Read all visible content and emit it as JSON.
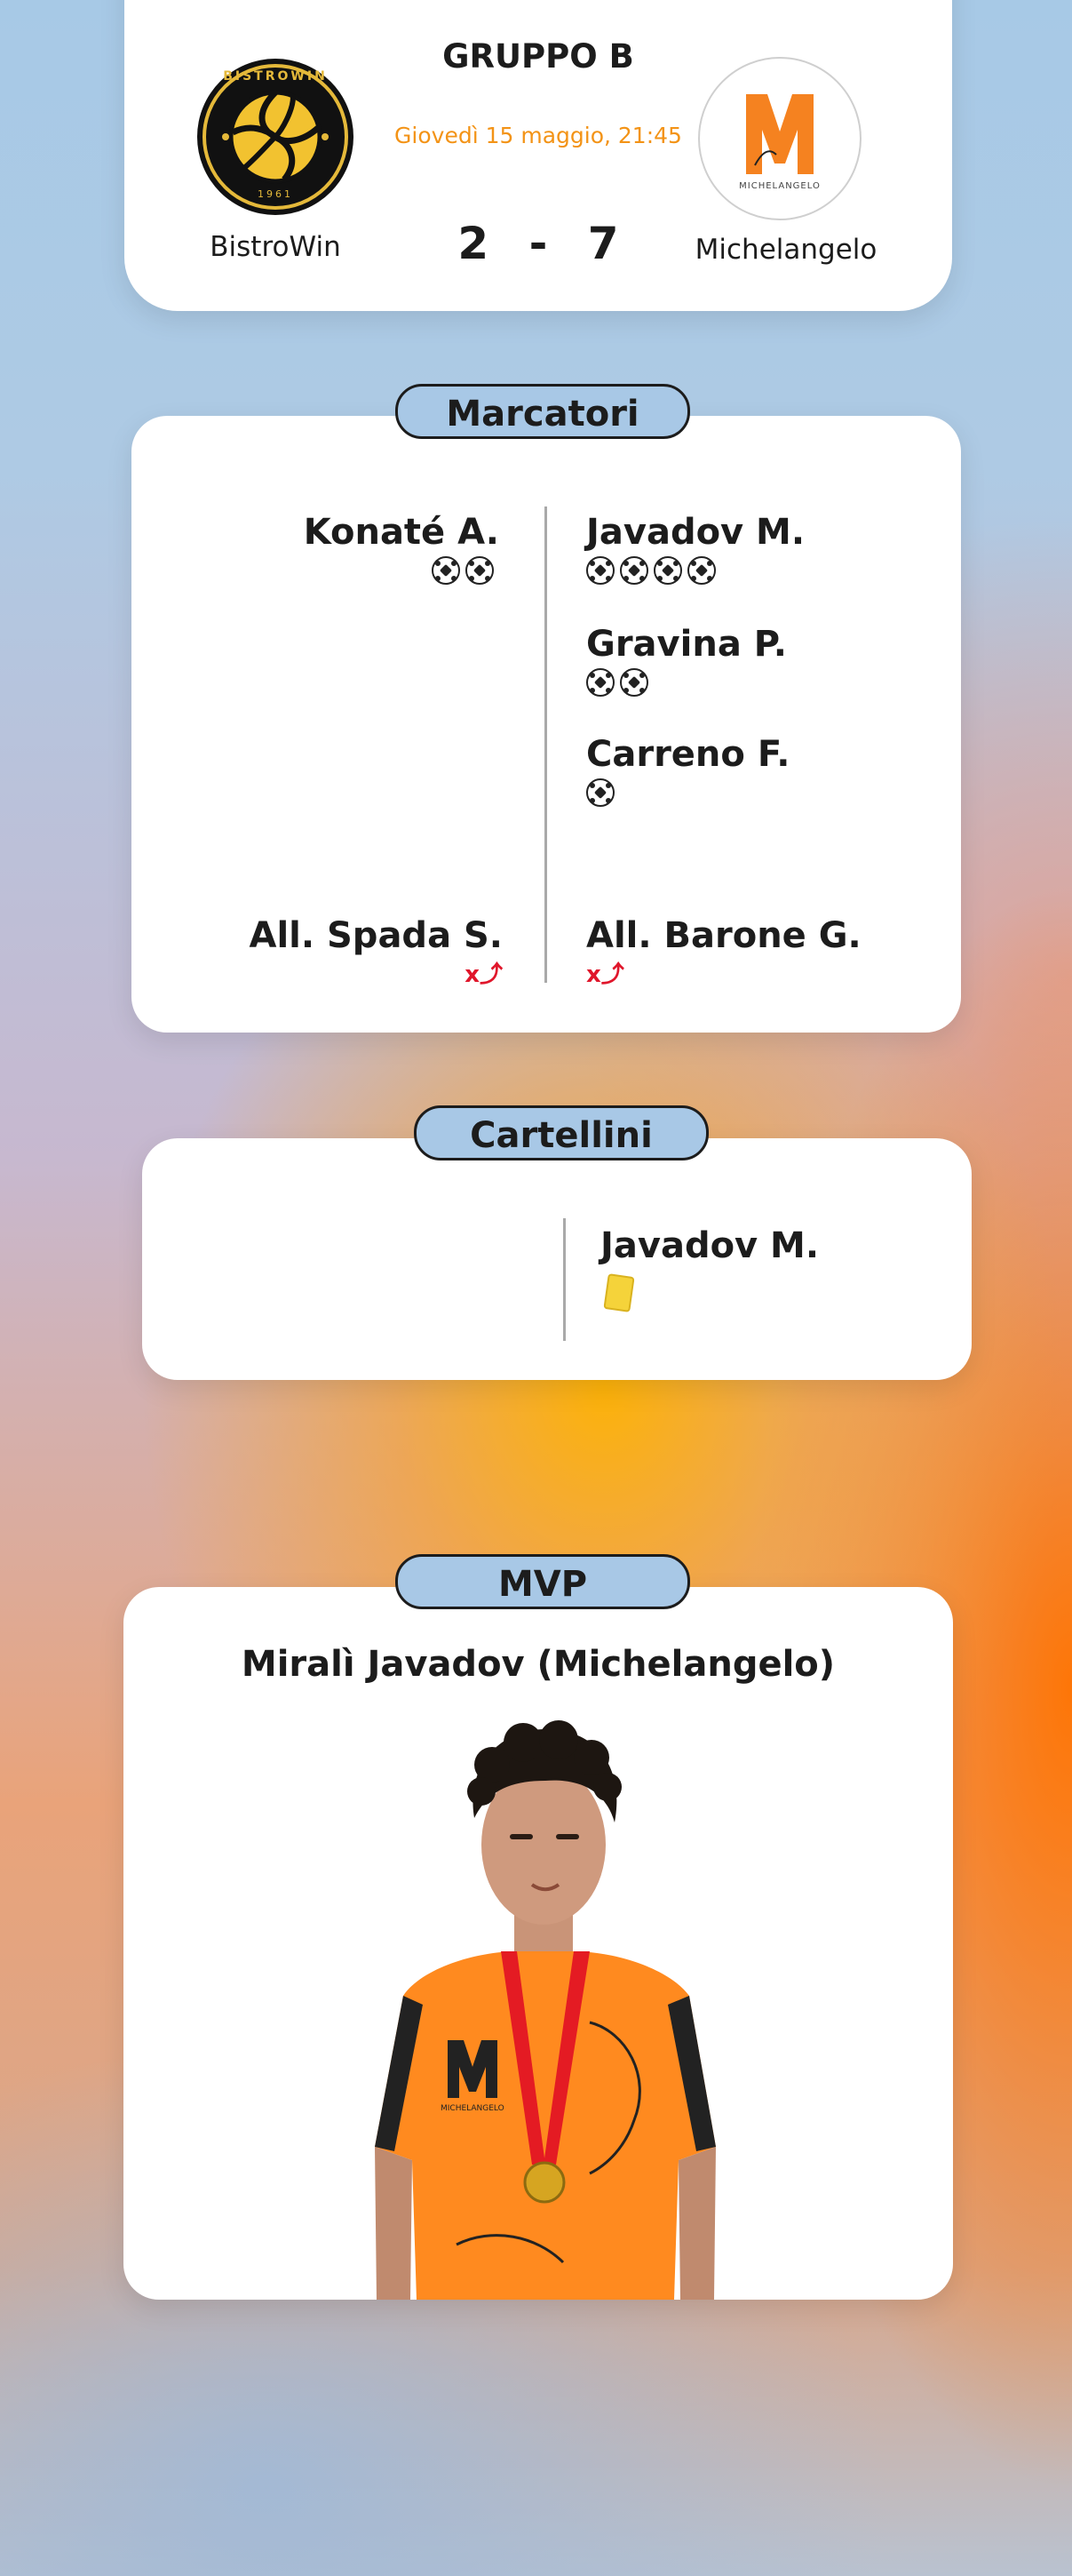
{
  "match": {
    "group": "GRUPPO B",
    "datetime": "Giovedì 15 maggio, 21:45",
    "home_team": "BistroWin",
    "away_team": "Michelangelo",
    "home_score": "2",
    "score_separator": "-",
    "away_score": "7",
    "home_logo": {
      "top_text": "BISTROWIN",
      "bottom_text": "1961",
      "icon": "soccer-ball-icon"
    },
    "away_logo": {
      "letter": "M",
      "caption": "MICHELANGELO"
    }
  },
  "scorers": {
    "title": "Marcatori",
    "home": [
      {
        "name": "Konaté A.",
        "goals": 2
      }
    ],
    "away": [
      {
        "name": "Javadov M.",
        "goals": 4
      },
      {
        "name": "Gravina P.",
        "goals": 2
      },
      {
        "name": "Carreno F.",
        "goals": 1
      }
    ],
    "home_coach": "All. Spada S.",
    "away_coach": "All. Barone G.",
    "coach_icon_text": "x⤴"
  },
  "cards": {
    "title": "Cartellini",
    "away": [
      {
        "name": "Javadov M.",
        "card": "yellow-card-icon"
      }
    ]
  },
  "mvp": {
    "title": "MVP",
    "player": "Miralì Javadov (Michelangelo)",
    "photo_logo_letter": "M",
    "photo_logo_caption": "MICHELANGELO"
  },
  "colors": {
    "accent_orange": "#f39316",
    "pill_blue": "#a8c8e6",
    "jersey_orange": "#ff8a1f",
    "yellow_card": "#f5d33a",
    "coach_red": "#e0162b"
  }
}
